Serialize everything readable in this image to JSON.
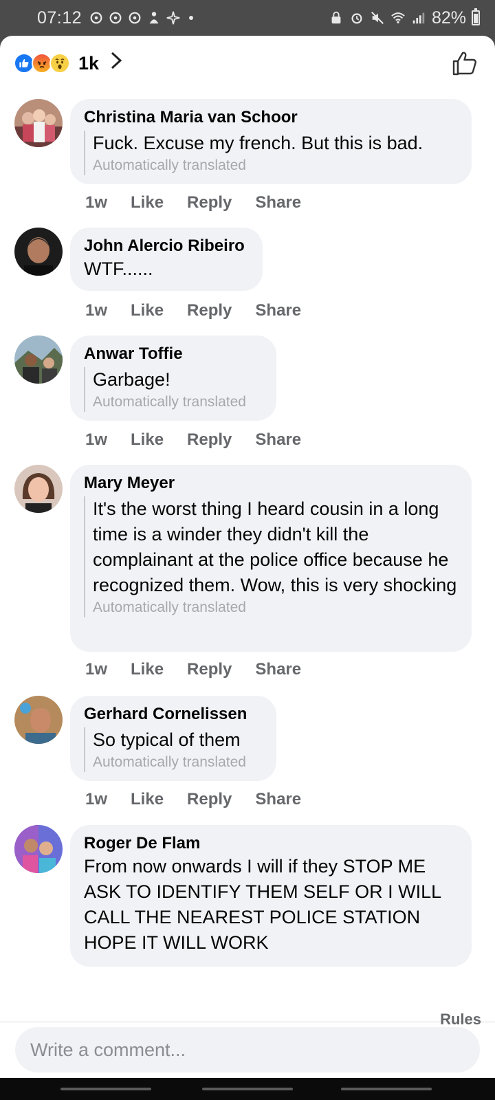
{
  "status_bar": {
    "time": "07:12",
    "battery": "82%"
  },
  "reactions": {
    "count": "1k",
    "types": [
      "like-icon",
      "angry-icon",
      "wow-icon"
    ]
  },
  "comments": [
    {
      "author": "Christina Maria van Schoor",
      "text": "Fuck. Excuse my french. But this is bad.",
      "translated_note": "Automatically translated",
      "time": "1w",
      "like": "Like",
      "reply": "Reply",
      "share": "Share"
    },
    {
      "author": "John Alercio Ribeiro",
      "text": "WTF......",
      "time": "1w",
      "like": "Like",
      "reply": "Reply",
      "share": "Share"
    },
    {
      "author": "Anwar Toffie",
      "text": "Garbage!",
      "translated_note": "Automatically translated",
      "time": "1w",
      "like": "Like",
      "reply": "Reply",
      "share": "Share"
    },
    {
      "author": "Mary Meyer",
      "text": "It's the worst thing I heard cousin in a long time is a winder they didn't kill the complainant at the police office because he recognized them. Wow, this is very shocking",
      "translated_note": "Automatically translated",
      "time": "1w",
      "like": "Like",
      "reply": "Reply",
      "share": "Share"
    },
    {
      "author": "Gerhard Cornelissen",
      "text": "So typical of them",
      "translated_note": "Automatically translated",
      "time": "1w",
      "like": "Like",
      "reply": "Reply",
      "share": "Share"
    },
    {
      "author": "Roger De Flam",
      "text": "From now onwards I will if they STOP ME ASK TO IDENTIFY THEM SELF OR  I WILL CALL THE NEAREST POLICE STATION HOPE IT WILL WORK"
    }
  ],
  "footer": {
    "rules": "Rules",
    "comment_placeholder": "Write a comment..."
  },
  "colors": {
    "bubble": "#f0f2f5",
    "meta_text": "#65676b",
    "like_blue": "#1877f2"
  }
}
